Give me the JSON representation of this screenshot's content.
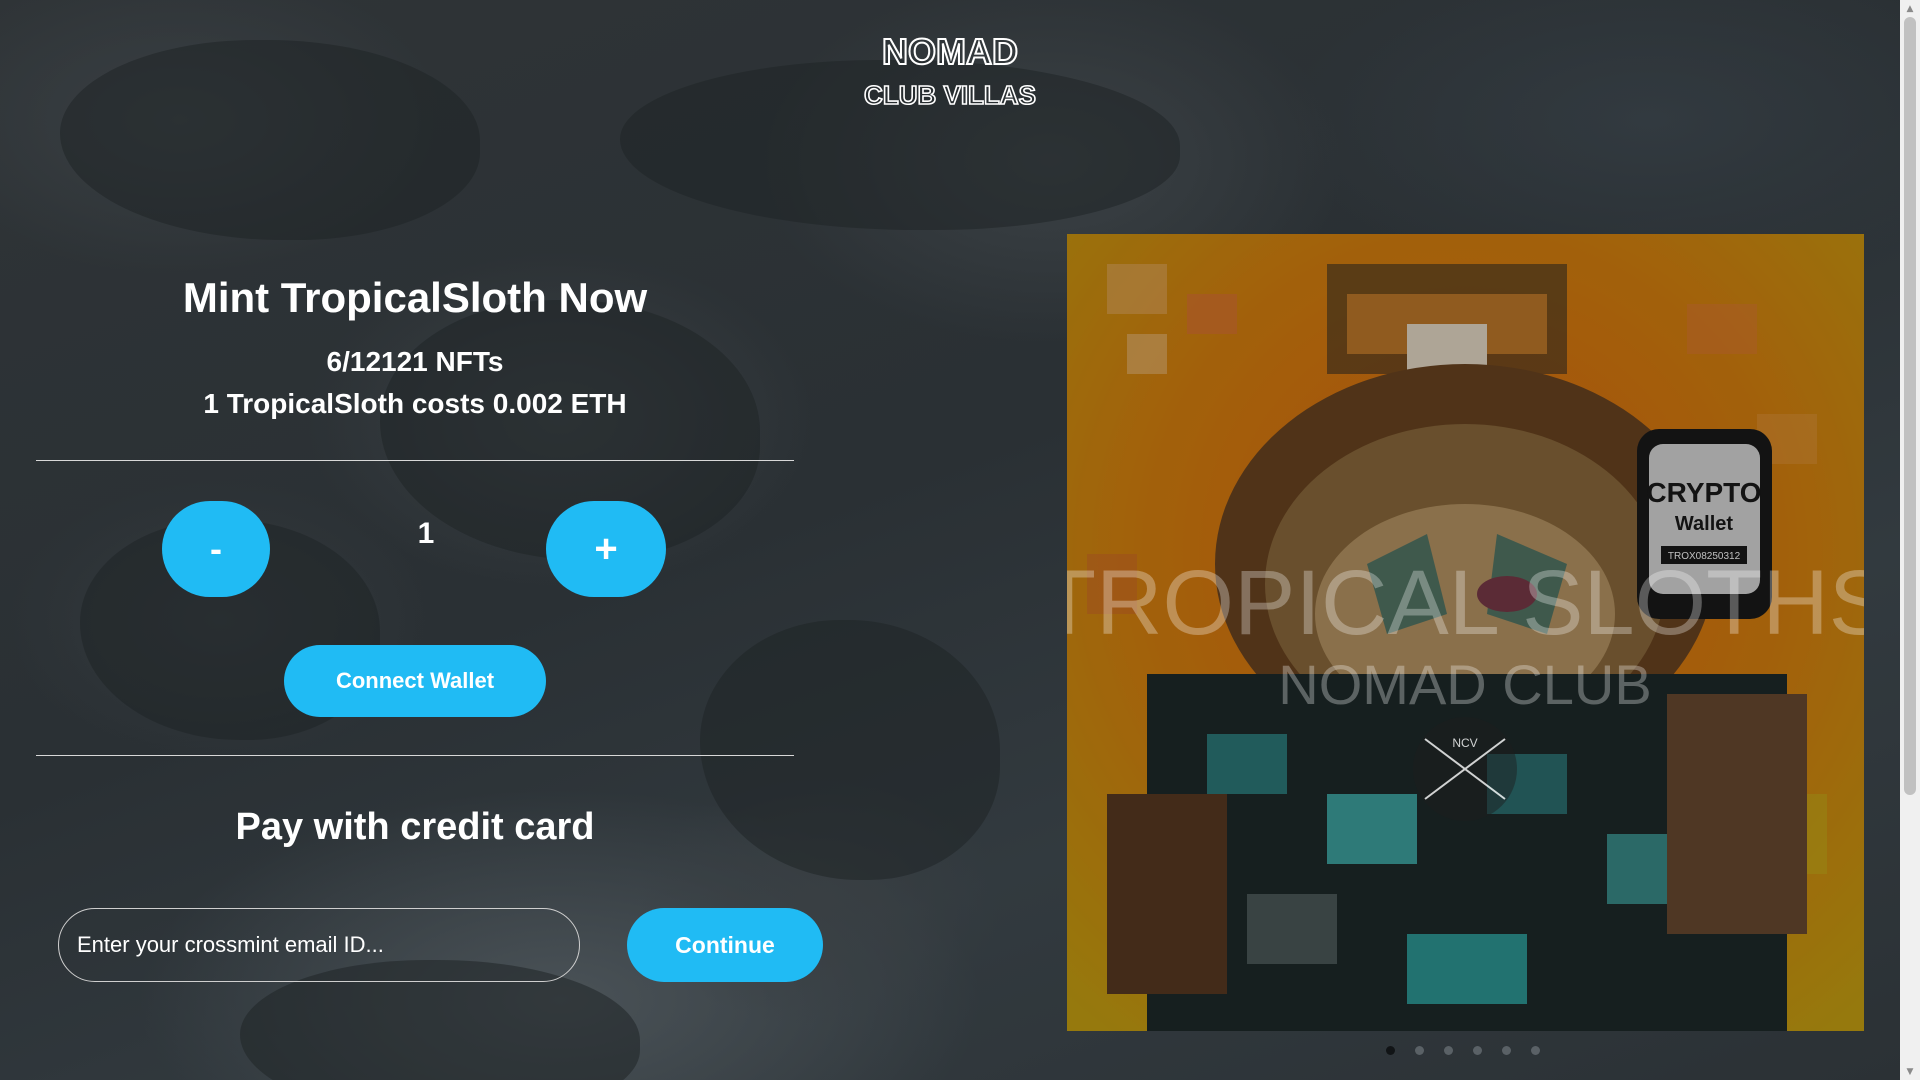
{
  "logo": {
    "line1": "NOMAD",
    "line2": "CLUB VILLAS"
  },
  "mint": {
    "title": "Mint TropicalSloth Now",
    "count_text": "6/12121 NFTs",
    "cost_text": "1 TropicalSloth costs 0.002 ETH",
    "minus_label": "-",
    "plus_label": "+",
    "quantity": "1",
    "connect_label": "Connect Wallet"
  },
  "credit": {
    "title": "Pay with credit card",
    "email_placeholder": "Enter your crossmint email ID...",
    "continue_label": "Continue"
  },
  "nft": {
    "watermark_main": "TROPICAL SLOTHS",
    "watermark_sub": "NOMAD CLUB",
    "badge_text": "NCV",
    "wallet_line1": "CRYPTO",
    "wallet_line2": "Wallet",
    "wallet_id": "TROX08250312"
  },
  "carousel": {
    "dot_count": 6,
    "active_index": 0
  },
  "colors": {
    "accent": "#20bbf4",
    "text": "#ffffff"
  }
}
